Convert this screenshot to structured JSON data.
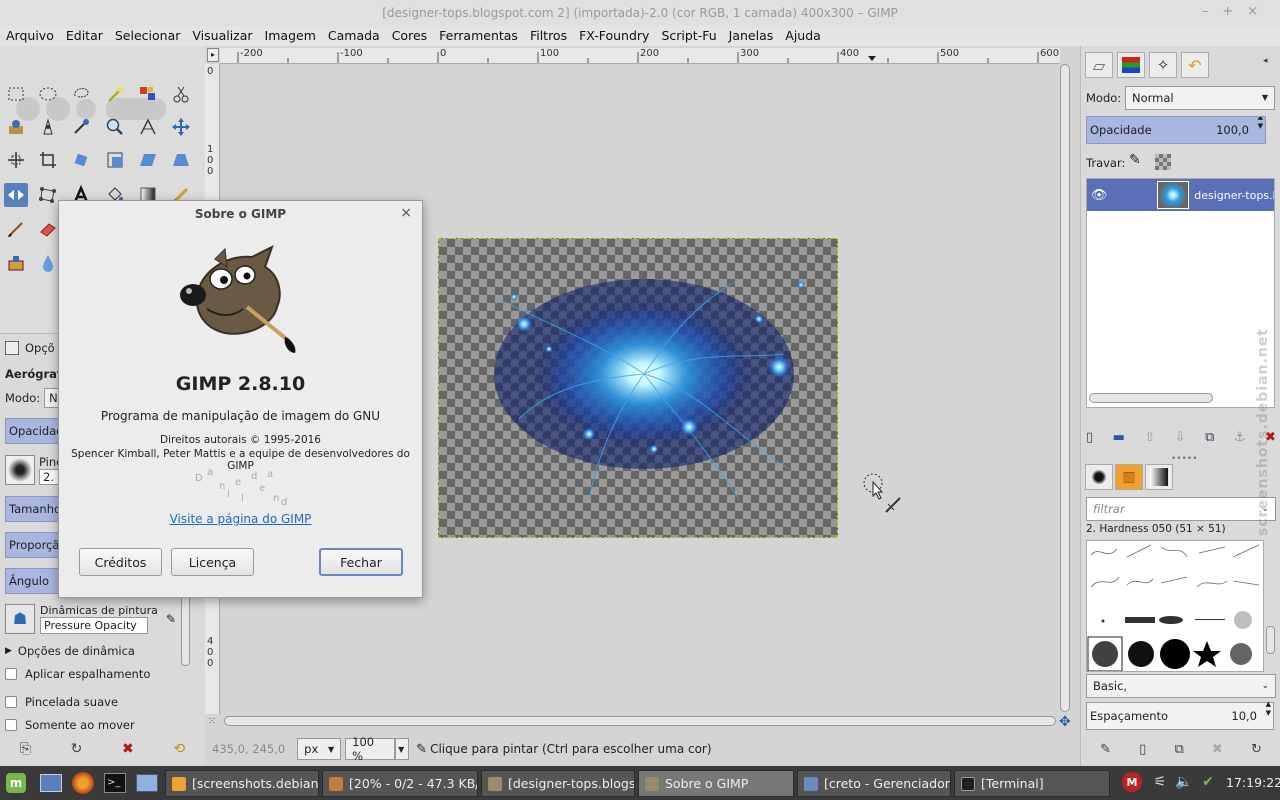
{
  "window": {
    "title": "[designer-tops.blogspot.com 2] (importada)-2.0 (cor RGB, 1 camada) 400x300 – GIMP"
  },
  "menu": [
    "Arquivo",
    "Editar",
    "Selecionar",
    "Visualizar",
    "Imagem",
    "Camada",
    "Cores",
    "Ferramentas",
    "Filtros",
    "FX-Foundry",
    "Script-Fu",
    "Janelas",
    "Ajuda"
  ],
  "rulers": {
    "h": [
      "-200",
      "-100",
      "0",
      "100",
      "200",
      "300",
      "400",
      "500",
      "600"
    ],
    "v_top": "0",
    "v_mid": "1 0 0",
    "v_bottom": "4 0 0"
  },
  "tool_options": {
    "tab_label": "Opçõ",
    "tool_name": "Aerógrafo",
    "mode_label": "Modo:",
    "mode_value": "No",
    "opacity_label": "Opacidade",
    "brush_label": "Pinc",
    "brush_value": "2.",
    "size_label": "Tamanho",
    "ratio_label": "Proporção",
    "angle_label": "Ângulo",
    "dynamics_label": "Dinâmicas de pintura",
    "dynamics_value": "Pressure Opacity",
    "dynamics_options": "Opções de dinâmica",
    "jitter": "Aplicar espalhamento",
    "smooth": "Pincelada suave",
    "rest": "Somente ao mover"
  },
  "status": {
    "coords": "435,0, 245,0",
    "unit": "px",
    "zoom": "100 %",
    "message": "Clique para pintar (Ctrl para escolher uma cor)"
  },
  "layers": {
    "mode_label": "Modo:",
    "mode_value": "Normal",
    "opacity_label": "Opacidade",
    "opacity_value": "100,0",
    "lock_label": "Travar:",
    "layer_name": "designer-tops.b"
  },
  "brushes": {
    "filter_placeholder": "filtrar",
    "current": "2. Hardness 050 (51 × 51)",
    "tag": "Basic,",
    "spacing_label": "Espaçamento",
    "spacing_value": "10,0"
  },
  "watermark": "screenshots.debian.net",
  "about": {
    "title": "Sobre o GIMP",
    "version": "GIMP 2.8.10",
    "subtitle": "Programa de manipulação de imagem do GNU",
    "copyright": "Direitos autorais © 1995-2016",
    "authors": "Spencer Kimball, Peter Mattis e a equipe de desenvolvedores do GIMP",
    "link": "Visite a página do GIMP",
    "credits_btn": "Créditos",
    "license_btn": "Licença",
    "close_btn": "Fechar"
  },
  "taskbar": {
    "tasks": [
      "[screenshots.debian....",
      "[20% - 0/2 - 47.3 KB/s...",
      "[designer-tops.blogs...",
      "Sobre o GIMP",
      "[creto - Gerenciador ...",
      "[Terminal]"
    ],
    "clock": "17:19:22"
  },
  "colors": {
    "accent": "#a8b6e0",
    "selected_layer": "#5a6fb8",
    "taskbar": "#3a3a3a"
  }
}
